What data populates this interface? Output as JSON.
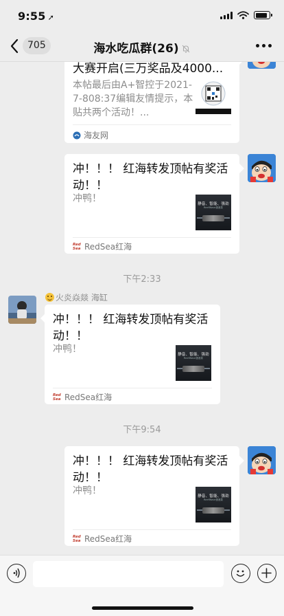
{
  "status_bar": {
    "time": "9:55",
    "location_arrow": "➚"
  },
  "header": {
    "back_count": "705",
    "title": "海水吃瓜群(26)",
    "mute_icon": "bell-slash-icon",
    "more_icon": "more-dots-icon"
  },
  "messages": [
    {
      "type": "link-card",
      "side": "right",
      "title": "大赛开启(三万奖品及4000...",
      "description": "本帖最后由A+智控于2021-7-808:37编辑友情提示，本贴共两个活动！...",
      "thumb_text": "",
      "source": "海友网"
    },
    {
      "type": "link-card",
      "side": "right",
      "title": "冲！！！ 红海转发顶帖有奖活动！！",
      "description": "冲鸭！",
      "thumb_text": "静音、智能、强劲",
      "thumb_sub": "ReefWave造浪泵",
      "source": "RedSea红海",
      "source_logo": "Red Sea"
    },
    {
      "type": "timestamp",
      "text": "下午2:33"
    },
    {
      "type": "link-card",
      "side": "left",
      "sender": "火炎焱燚 海缸",
      "title": "冲！！！ 红海转发顶帖有奖活动！！",
      "description": "冲鸭！",
      "thumb_text": "静音、智能、强劲",
      "thumb_sub": "ReefWave造浪泵",
      "source": "RedSea红海",
      "source_logo": "Red Sea"
    },
    {
      "type": "timestamp",
      "text": "下午9:54"
    },
    {
      "type": "link-card",
      "side": "right",
      "title": "冲！！！ 红海转发顶帖有奖活动！！",
      "description": "冲鸭！",
      "thumb_text": "静音、智能、强劲",
      "thumb_sub": "ReefWave造浪泵",
      "source": "RedSea红海",
      "source_logo": "Red Sea"
    }
  ],
  "input_bar": {
    "voice_icon": "voice-icon",
    "emoji_icon": "emoji-icon",
    "plus_icon": "plus-icon",
    "placeholder": ""
  }
}
